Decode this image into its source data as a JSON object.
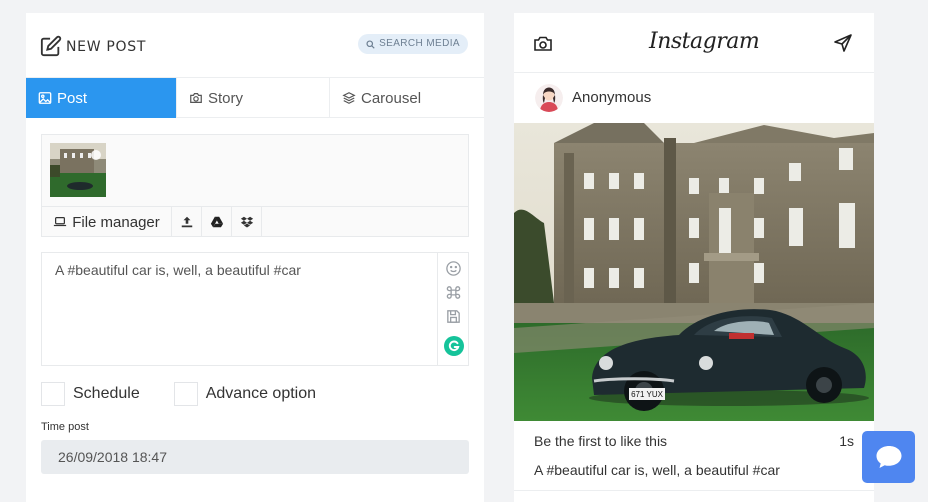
{
  "composer": {
    "title": "NEW POST",
    "search_media": "SEARCH MEDIA",
    "tabs": [
      {
        "label": "Post",
        "icon": "image-icon",
        "active": true
      },
      {
        "label": "Story",
        "icon": "camera-icon",
        "active": false
      },
      {
        "label": "Carousel",
        "icon": "layers-icon",
        "active": false
      }
    ],
    "media_tools": {
      "file_manager": "File manager",
      "icons": [
        "upload-icon",
        "google-drive-icon",
        "dropbox-icon"
      ]
    },
    "caption": "A #beautiful car is, well, a beautiful #car",
    "caption_tools": [
      "emoji-icon",
      "command-icon",
      "save-icon",
      "grammarly-icon"
    ],
    "options": {
      "schedule": "Schedule",
      "advance": "Advance option"
    },
    "time_post_label": "Time post",
    "time_post_value": "26/09/2018 18:47"
  },
  "preview": {
    "brand": "Instagram",
    "username": "Anonymous",
    "likes_text": "Be the first to like this",
    "time_ago": "1s",
    "caption": "A #beautiful car is, well, a beautiful #car",
    "plate": "671 YUX"
  },
  "colors": {
    "accent": "#2b96ef",
    "chat_button": "#4f86f0",
    "grammarly": "#15c39a"
  }
}
